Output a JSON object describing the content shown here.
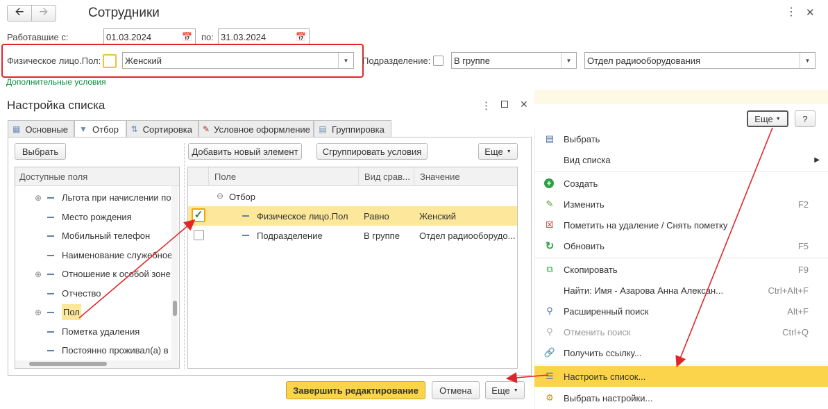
{
  "window": {
    "title": "Сотрудники"
  },
  "filters": {
    "worked_from_label": "Работавшие с:",
    "date_from": "01.03.2024",
    "to_label": "по:",
    "date_to": "31.03.2024",
    "gender_label": "Физическое лицо.Пол:",
    "gender_value": "Женский",
    "department_label": "Подразделение:",
    "department_mode": "В группе",
    "department_value": "Отдел радиооборудования",
    "extra_conditions": "Дополнительные условия"
  },
  "dialog": {
    "title": "Настройка списка",
    "tabs": [
      {
        "label": "Основные"
      },
      {
        "label": "Отбор"
      },
      {
        "label": "Сортировка"
      },
      {
        "label": "Условное оформление"
      },
      {
        "label": "Группировка"
      }
    ],
    "select_button": "Выбрать",
    "available_fields_header": "Доступные поля",
    "fields": [
      "Льгота при начислении пос",
      "Место рождения",
      "Мобильный телефон",
      "Наименование служебное",
      "Отношение к особой зоне",
      "Отчество",
      "Пол",
      "Пометка удаления",
      "Постоянно проживал(а) в К"
    ],
    "add_element_button": "Добавить новый элемент",
    "group_conditions_button": "Сгруппировать условия",
    "more_button": "Еще",
    "columns": {
      "field": "Поле",
      "comparison": "Вид срав...",
      "value": "Значение"
    },
    "group_label": "Отбор",
    "rows": [
      {
        "field": "Физическое лицо.Пол",
        "comparison": "Равно",
        "value": "Женский"
      },
      {
        "field": "Подразделение",
        "comparison": "В группе",
        "value": "Отдел радиооборудо..."
      }
    ],
    "finish_button": "Завершить редактирование",
    "cancel_button": "Отмена",
    "more_button2": "Еще"
  },
  "toolbar": {
    "more": "Еще",
    "help": "?"
  },
  "menu": {
    "items": [
      {
        "label": "Выбрать",
        "shortcut": ""
      },
      {
        "label": "Вид списка",
        "shortcut": ""
      },
      {
        "label": "Создать",
        "shortcut": ""
      },
      {
        "label": "Изменить",
        "shortcut": "F2"
      },
      {
        "label": "Пометить на удаление / Снять пометку",
        "shortcut": ""
      },
      {
        "label": "Обновить",
        "shortcut": "F5"
      },
      {
        "label": "Скопировать",
        "shortcut": "F9"
      },
      {
        "label": "Найти: Имя - Азарова Анна Алексан...",
        "shortcut": "Ctrl+Alt+F"
      },
      {
        "label": "Расширенный поиск",
        "shortcut": "Alt+F"
      },
      {
        "label": "Отменить поиск",
        "shortcut": "Ctrl+Q"
      },
      {
        "label": "Получить ссылку...",
        "shortcut": ""
      },
      {
        "label": "Настроить список...",
        "shortcut": ""
      },
      {
        "label": "Выбрать настройки...",
        "shortcut": ""
      }
    ]
  },
  "colors": {
    "highlight_red": "#e0262b",
    "accent_yellow": "#fbd44c",
    "green_link": "#0a8f3c"
  }
}
